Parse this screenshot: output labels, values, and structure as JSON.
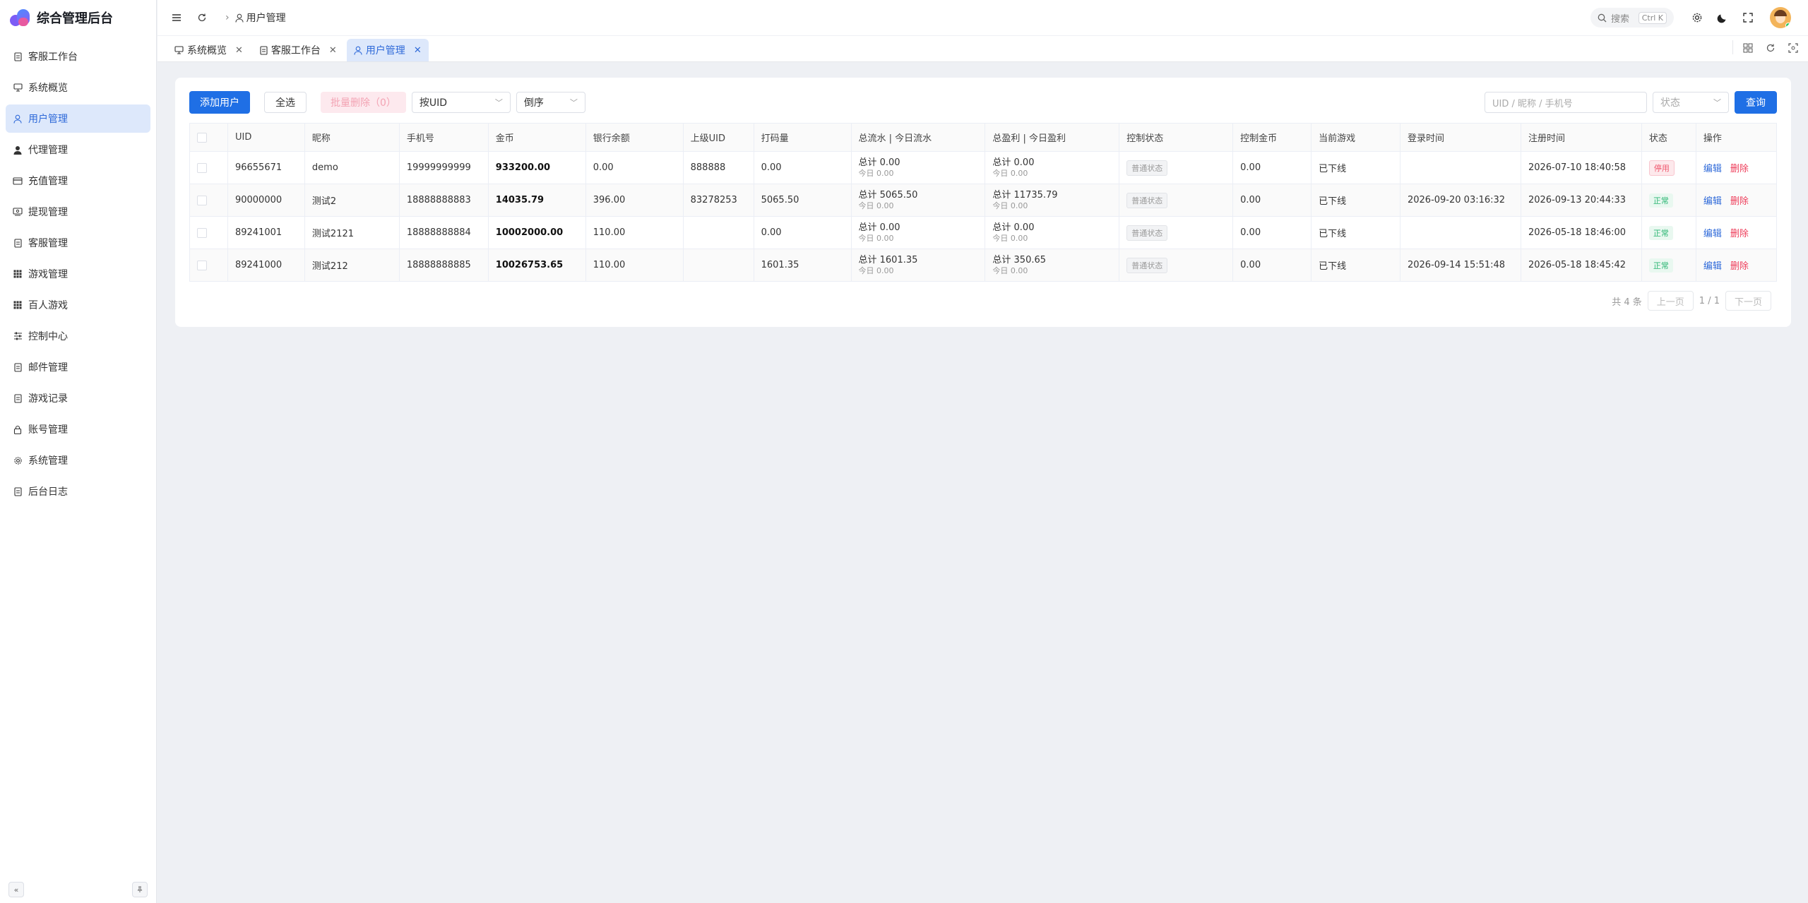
{
  "app": {
    "title": "综合管理后台"
  },
  "sidebar": {
    "items": [
      {
        "label": "客服工作台",
        "icon": "doc-icon"
      },
      {
        "label": "系统概览",
        "icon": "monitor-icon"
      },
      {
        "label": "用户管理",
        "icon": "user-icon",
        "active": true
      },
      {
        "label": "代理管理",
        "icon": "person-icon"
      },
      {
        "label": "充值管理",
        "icon": "card-icon"
      },
      {
        "label": "提现管理",
        "icon": "cash-icon"
      },
      {
        "label": "客服管理",
        "icon": "doc-icon"
      },
      {
        "label": "游戏管理",
        "icon": "grid-icon"
      },
      {
        "label": "百人游戏",
        "icon": "grid-icon"
      },
      {
        "label": "控制中心",
        "icon": "sliders-icon"
      },
      {
        "label": "邮件管理",
        "icon": "doc-icon"
      },
      {
        "label": "游戏记录",
        "icon": "doc-icon"
      },
      {
        "label": "账号管理",
        "icon": "lock-icon"
      },
      {
        "label": "系统管理",
        "icon": "gear-icon"
      },
      {
        "label": "后台日志",
        "icon": "doc-icon"
      }
    ]
  },
  "header": {
    "breadcrumb": "用户管理",
    "search_placeholder": "搜索",
    "search_shortcut": "Ctrl K"
  },
  "tabs": [
    {
      "label": "系统概览"
    },
    {
      "label": "客服工作台"
    },
    {
      "label": "用户管理",
      "active": true
    }
  ],
  "toolbar": {
    "add_user": "添加用户",
    "select_all": "全选",
    "batch_delete": "批量删除（0）",
    "sort_by": "按UID",
    "order": "倒序",
    "search_placeholder": "UID / 昵称 / 手机号",
    "status_placeholder": "状态",
    "query": "查询"
  },
  "table": {
    "headers": [
      "UID",
      "昵称",
      "手机号",
      "金币",
      "银行余额",
      "上级UID",
      "打码量",
      "总流水 | 今日流水",
      "总盈利 | 今日盈利",
      "控制状态",
      "控制金币",
      "当前游戏",
      "登录时间",
      "注册时间",
      "状态",
      "操作"
    ],
    "rows": [
      {
        "uid": "96655671",
        "nickname": "demo",
        "phone": "19999999999",
        "coins": "933200.00",
        "bank": "0.00",
        "parent": "888888",
        "bet": "0.00",
        "flow_total": "总计 0.00",
        "flow_today": "今日 0.00",
        "profit_total": "总计 0.00",
        "profit_today": "今日 0.00",
        "control": "普通状态",
        "control_coins": "0.00",
        "game": "已下线",
        "login": "",
        "register": "2026-07-10 18:40:58",
        "status": "停用",
        "status_type": "red"
      },
      {
        "uid": "90000000",
        "nickname": "测试2",
        "phone": "18888888883",
        "coins": "14035.79",
        "bank": "396.00",
        "parent": "83278253",
        "bet": "5065.50",
        "flow_total": "总计 5065.50",
        "flow_today": "今日 0.00",
        "profit_total": "总计 11735.79",
        "profit_today": "今日 0.00",
        "control": "普通状态",
        "control_coins": "0.00",
        "game": "已下线",
        "login": "2026-09-20 03:16:32",
        "register": "2026-09-13 20:44:33",
        "status": "正常",
        "status_type": "green"
      },
      {
        "uid": "89241001",
        "nickname": "测试2121",
        "phone": "18888888884",
        "coins": "10002000.00",
        "bank": "110.00",
        "parent": "",
        "bet": "0.00",
        "flow_total": "总计 0.00",
        "flow_today": "今日 0.00",
        "profit_total": "总计 0.00",
        "profit_today": "今日 0.00",
        "control": "普通状态",
        "control_coins": "0.00",
        "game": "已下线",
        "login": "",
        "register": "2026-05-18 18:46:00",
        "status": "正常",
        "status_type": "green"
      },
      {
        "uid": "89241000",
        "nickname": "测试212",
        "phone": "18888888885",
        "coins": "10026753.65",
        "bank": "110.00",
        "parent": "",
        "bet": "1601.35",
        "flow_total": "总计 1601.35",
        "flow_today": "今日 0.00",
        "profit_total": "总计 350.65",
        "profit_today": "今日 0.00",
        "control": "普通状态",
        "control_coins": "0.00",
        "game": "已下线",
        "login": "2026-09-14 15:51:48",
        "register": "2026-05-18 18:45:42",
        "status": "正常",
        "status_type": "green"
      }
    ],
    "action_edit": "编辑",
    "action_delete": "删除"
  },
  "pager": {
    "total": "共 4 条",
    "prev": "上一页",
    "page": "1 / 1",
    "next": "下一页"
  },
  "colors": {
    "primary": "#1f6fe5",
    "active_bg": "#dde8fb",
    "danger": "#ee3d5a",
    "success": "#2bb673"
  }
}
